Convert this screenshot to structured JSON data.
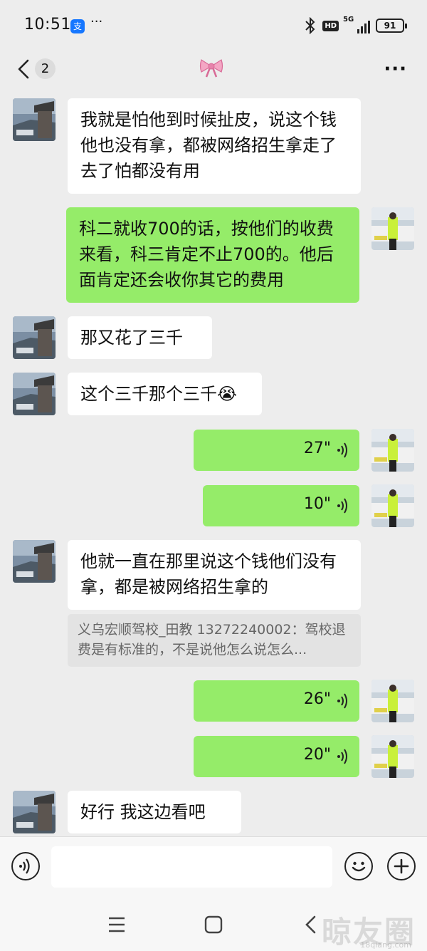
{
  "status": {
    "time": "10:51",
    "alipay_glyph": "支",
    "dots": "···",
    "hd": "HD",
    "network": "5G",
    "battery": "91"
  },
  "header": {
    "unread_count": "2",
    "title_emoji": "🎀",
    "more": "···"
  },
  "messages": [
    {
      "text": "我就是怕他到时候扯皮，说这个钱他也没有拿，都被网络招生拿走了 去了怕都没有用"
    },
    {
      "text": "科二就收700的话，按他们的收费来看，科三肯定不止700的。他后面肯定还会收你其它的费用"
    },
    {
      "text": "那又花了三千"
    },
    {
      "text": "这个三千那个三千😭"
    },
    {
      "duration": "27\""
    },
    {
      "duration": "10\""
    },
    {
      "text": "他就一直在那里说这个钱他们没有拿，都是被网络招生拿的"
    },
    {
      "quote": "义乌宏顺驾校_田教 13272240002：驾校退费是有标准的，不是说他怎么说怎么..."
    },
    {
      "duration": "26\""
    },
    {
      "duration": "20\""
    },
    {
      "text": "好行 我这边看吧"
    }
  ],
  "watermark": {
    "text": "晾友圈",
    "sub": "18qiang.com"
  },
  "colors": {
    "sent_bubble": "#95ec69",
    "received_bubble": "#ffffff",
    "background": "#ededed"
  }
}
